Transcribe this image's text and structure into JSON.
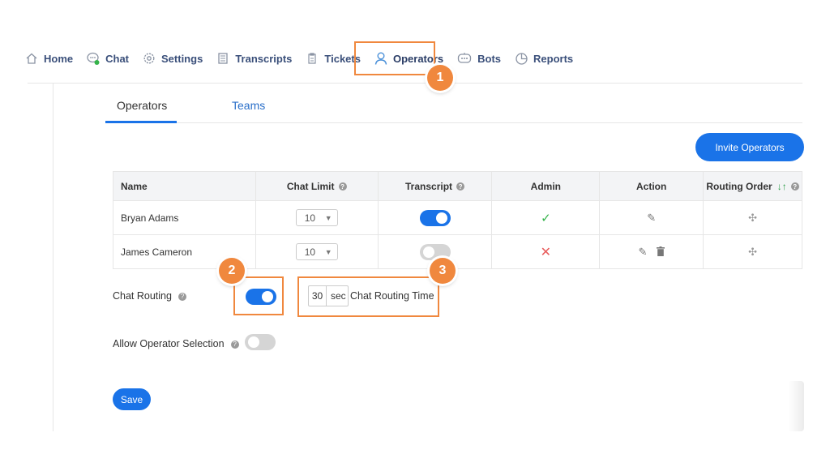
{
  "nav": {
    "items": [
      {
        "label": "Home",
        "icon": "home-icon"
      },
      {
        "label": "Chat",
        "icon": "chat-icon"
      },
      {
        "label": "Settings",
        "icon": "gear-icon"
      },
      {
        "label": "Transcripts",
        "icon": "document-icon"
      },
      {
        "label": "Tickets",
        "icon": "ticket-icon"
      },
      {
        "label": "Operators",
        "icon": "user-icon",
        "active": true
      },
      {
        "label": "Bots",
        "icon": "bot-icon"
      },
      {
        "label": "Reports",
        "icon": "pie-chart-icon"
      }
    ]
  },
  "annotations": {
    "one": "1",
    "two": "2",
    "three": "3",
    "color": "#f0883e"
  },
  "tabs": {
    "operators": "Operators",
    "teams": "Teams"
  },
  "invite_label": "Invite Operators",
  "table": {
    "headers": {
      "name": "Name",
      "chat_limit": "Chat Limit",
      "transcript": "Transcript",
      "admin": "Admin",
      "action": "Action",
      "routing_order": "Routing Order"
    },
    "rows": [
      {
        "name": "Bryan Adams",
        "chat_limit": "10",
        "transcript": "on",
        "admin": "yes",
        "can_delete": false
      },
      {
        "name": "James Cameron",
        "chat_limit": "10",
        "transcript": "off",
        "admin": "no",
        "can_delete": true
      }
    ]
  },
  "chat_routing": {
    "label": "Chat Routing",
    "enabled": true,
    "time_value": "30",
    "time_unit": "sec",
    "time_label": "Chat Routing Time"
  },
  "operator_selection": {
    "label": "Allow Operator Selection",
    "enabled": false
  },
  "save_label": "Save",
  "colors": {
    "accent": "#1a73e8",
    "success": "#35b34a",
    "danger": "#e85c5c",
    "nav_text": "#3a4f7a"
  }
}
